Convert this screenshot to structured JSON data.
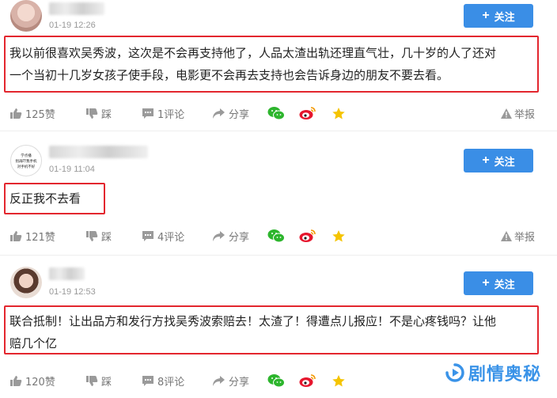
{
  "follow_label": "关注",
  "comments": [
    {
      "time": "01-19 12:26",
      "text_line1": "我以前很喜欢吴秀波，这次是不会再支持他了，人品太渣出轨还理直气壮，几十岁的人了还对",
      "text_line2": "一个当初十几岁女孩子使手段，电影更不会再去支持也会告诉身边的朋友不要去看。",
      "likes": "125赞",
      "dislike": "踩",
      "comments_count": "1评论",
      "share": "分享",
      "report": "举报"
    },
    {
      "time": "01-19 11:04",
      "avatar_text": [
        "学点播",
        "别再吓我手机",
        "对手机不好"
      ],
      "text_line1": "反正我不去看",
      "likes": "121赞",
      "dislike": "踩",
      "comments_count": "4评论",
      "share": "分享",
      "report": "举报"
    },
    {
      "time": "01-19 12:53",
      "text_line1": "联合抵制！让出品方和发行方找吴秀波索赔去！太渣了！得遭点儿报应！不是心疼钱吗？让他",
      "text_line2": "赔几个亿",
      "likes": "120赞",
      "dislike": "踩",
      "comments_count": "8评论",
      "share": "分享"
    }
  ],
  "watermark": "剧情奥秘",
  "colors": {
    "follow_button": "#3a8ee6",
    "highlight_box": "#e3262e",
    "wechat": "#2db52d",
    "weibo": "#e6162d",
    "star": "#f5c400",
    "watermark": "#3a93e8"
  },
  "icons": [
    "thumbs-up-icon",
    "thumbs-down-icon",
    "comment-icon",
    "share-icon",
    "wechat-icon",
    "weibo-icon",
    "star-icon",
    "warning-icon"
  ]
}
